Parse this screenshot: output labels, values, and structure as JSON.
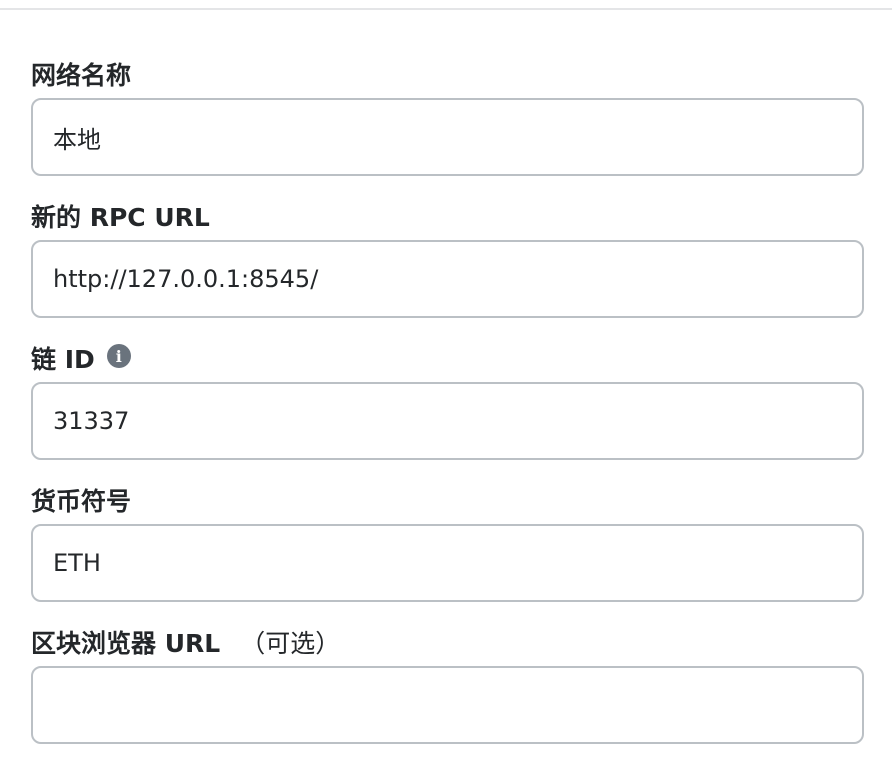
{
  "form": {
    "network_name": {
      "label": "网络名称",
      "value": "本地"
    },
    "rpc_url": {
      "label": "新的 RPC URL",
      "value": "http://127.0.0.1:8545/"
    },
    "chain_id": {
      "label": "链 ID",
      "info_icon": "i",
      "value": "31337"
    },
    "currency_symbol": {
      "label": "货币符号",
      "value": "ETH"
    },
    "block_explorer": {
      "label": "区块浏览器 URL",
      "optional_label": "（可选）",
      "value": ""
    }
  }
}
